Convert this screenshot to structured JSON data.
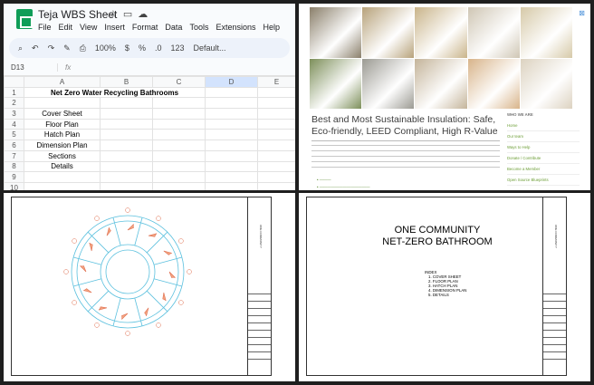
{
  "sheets": {
    "title": "Teja WBS Sheet",
    "menu": [
      "File",
      "Edit",
      "View",
      "Insert",
      "Format",
      "Data",
      "Tools",
      "Extensions",
      "Help"
    ],
    "toolbar": {
      "zoom": "100%",
      "currency": "$",
      "percent": "%",
      "decimal": ".0",
      "number": "123",
      "font": "Default..."
    },
    "cell_ref": "D13",
    "columns": [
      "A",
      "B",
      "C",
      "D",
      "E"
    ],
    "selected_column": "D",
    "rows": [
      {
        "n": "1",
        "a": "Net Zero Water Recycling Bathrooms"
      },
      {
        "n": "2",
        "a": ""
      },
      {
        "n": "3",
        "a": "Cover Sheet"
      },
      {
        "n": "4",
        "a": "Floor Plan"
      },
      {
        "n": "5",
        "a": "Hatch Plan"
      },
      {
        "n": "6",
        "a": "Dimension Plan"
      },
      {
        "n": "7",
        "a": "Sections"
      },
      {
        "n": "8",
        "a": "Details"
      },
      {
        "n": "9",
        "a": ""
      },
      {
        "n": "10",
        "a": ""
      }
    ]
  },
  "web": {
    "title": "Best and Most Sustainable Insulation: Safe, Eco-friendly, LEED Compliant, High R-Value",
    "sidebar_heading": "WHO WE ARE",
    "sidebar_links": [
      "Home",
      "Our team",
      "Ways to Help",
      "Donate / Contribute",
      "Become a Member",
      "Open Source Blueprints"
    ],
    "collage_colors": [
      "#8a7f6a",
      "#b7a27a",
      "#c9b48a",
      "#cfc6b4",
      "#d6c9a8",
      "#7d8f5a",
      "#9b9a92",
      "#c4b49a",
      "#d8b48a",
      "#dcd2c0"
    ]
  },
  "drawing2": {
    "title_line1": "ONE COMMUNITY",
    "title_line2": "NET-ZERO BATHROOM",
    "index_heading": "INDEX",
    "index_items": [
      "1. COVER SHEET",
      "2. FLOOR PLAN",
      "3. HATCH PLAN",
      "4. DIMENSION PLAN",
      "5. DETAILS"
    ]
  }
}
